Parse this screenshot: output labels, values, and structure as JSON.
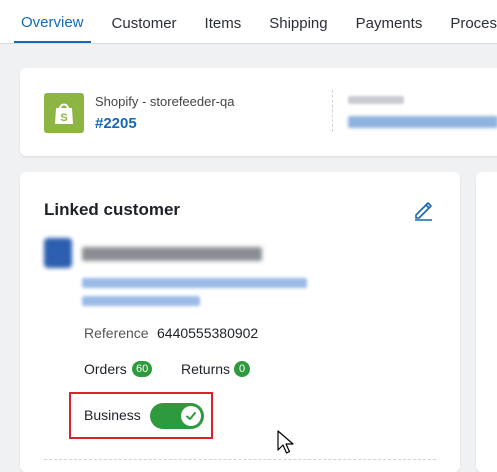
{
  "tabs": [
    {
      "label": "Overview",
      "active": true
    },
    {
      "label": "Customer"
    },
    {
      "label": "Items"
    },
    {
      "label": "Shipping"
    },
    {
      "label": "Payments"
    },
    {
      "label": "Process"
    }
  ],
  "order": {
    "shop_name": "Shopify - storefeeder-qa",
    "order_number": "#2205",
    "shop_icon": "shopify-bag-icon"
  },
  "linked_customer": {
    "title": "Linked customer",
    "edit_icon": "pencil-icon",
    "reference_label": "Reference",
    "reference_value": "6440555380902",
    "orders_label": "Orders",
    "orders_count": "60",
    "returns_label": "Returns",
    "returns_count": "0",
    "business_label": "Business",
    "business_enabled": true
  },
  "colors": {
    "accent": "#1669b5",
    "success": "#2e9a3e",
    "highlight": "#d9232d",
    "shopify": "#8db543"
  }
}
